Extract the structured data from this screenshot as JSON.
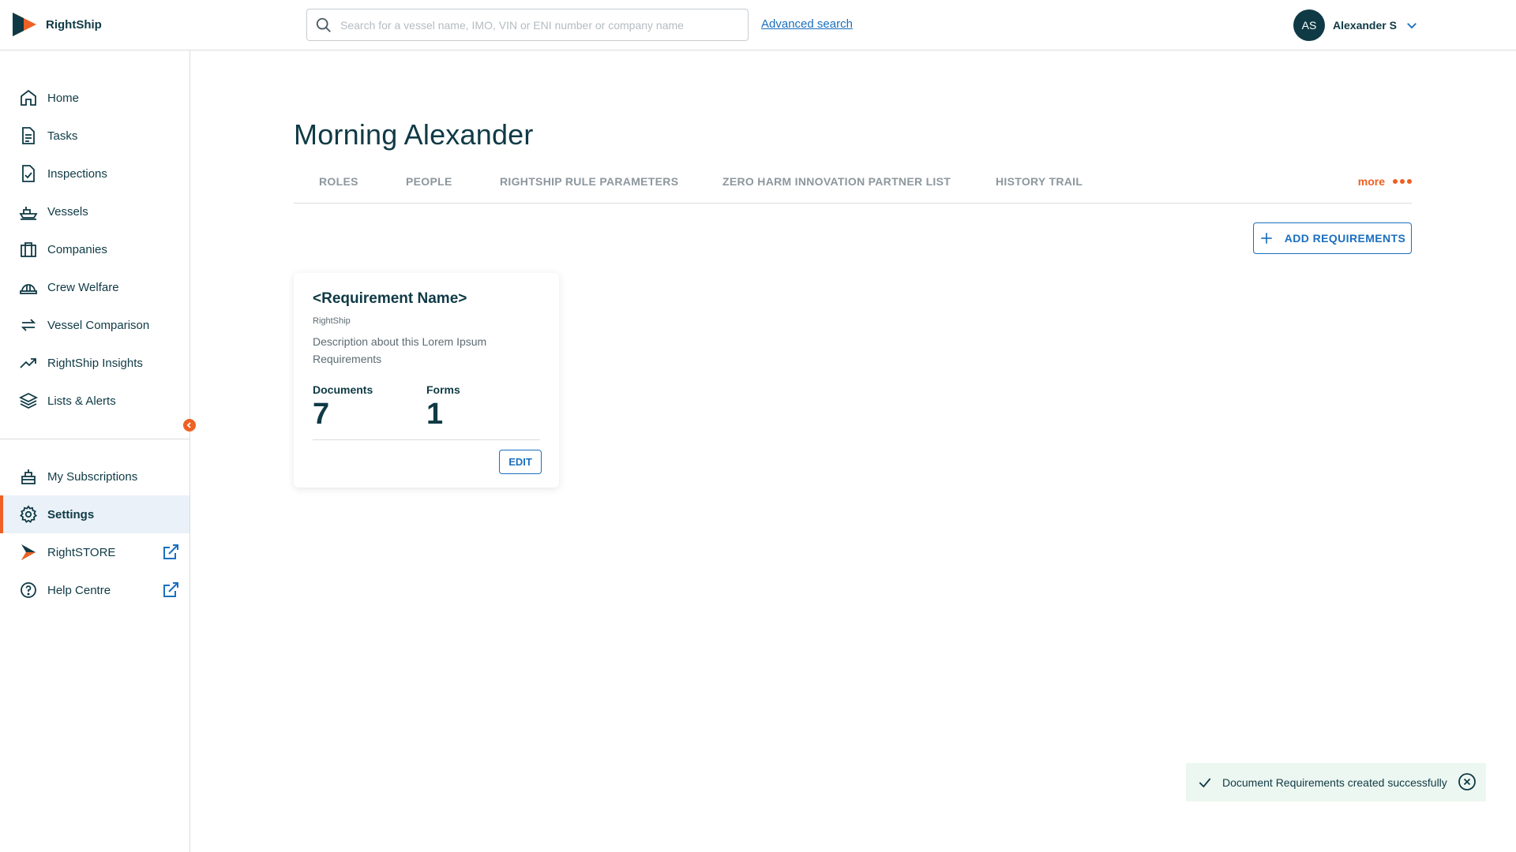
{
  "brand": {
    "name": "RightShip",
    "accent": "#ef6024",
    "primary": "#0f3a45",
    "link": "#1a6fbf"
  },
  "search": {
    "placeholder": "Search for a vessel name, IMO, VIN or ENI number or company name",
    "value": "",
    "advanced_label": "Advanced search"
  },
  "user": {
    "initials": "AS",
    "name": "Alexander S"
  },
  "sidebar": {
    "items": [
      {
        "label": "Home",
        "icon": "home-icon"
      },
      {
        "label": "Tasks",
        "icon": "document-icon"
      },
      {
        "label": "Inspections",
        "icon": "checklist-icon"
      },
      {
        "label": "Vessels",
        "icon": "ship-icon"
      },
      {
        "label": "Companies",
        "icon": "briefcase-icon"
      },
      {
        "label": "Crew Welfare",
        "icon": "hardhat-icon"
      },
      {
        "label": "Vessel Comparison",
        "icon": "swap-icon"
      },
      {
        "label": "RightShip Insights",
        "icon": "trending-icon"
      },
      {
        "label": "Lists & Alerts",
        "icon": "layers-icon"
      }
    ],
    "bottom_items": [
      {
        "label": "My Subscriptions",
        "icon": "subscription-icon"
      },
      {
        "label": "Settings",
        "icon": "gear-icon",
        "active": true
      },
      {
        "label": "RightSTORE",
        "icon": "rightstore-logo-icon",
        "external": true
      },
      {
        "label": "Help Centre",
        "icon": "help-icon",
        "external": true
      }
    ]
  },
  "main": {
    "greeting": "Morning Alexander",
    "tabs": [
      "ROLES",
      "PEOPLE",
      "RIGHTSHIP RULE PARAMETERS",
      "ZERO HARM INNOVATION PARTNER LIST",
      "HISTORY TRAIL"
    ],
    "more_label": "more",
    "add_button_label": "ADD REQUIREMENTS",
    "card": {
      "title": "<Requirement Name>",
      "company": "RightShip",
      "description": "Description about this Lorem Ipsum Requirements",
      "documents_label": "Documents",
      "documents_value": "7",
      "forms_label": "Forms",
      "forms_value": "1",
      "edit_label": "EDIT"
    }
  },
  "toast": {
    "message": "Document Requirements created successfully"
  }
}
